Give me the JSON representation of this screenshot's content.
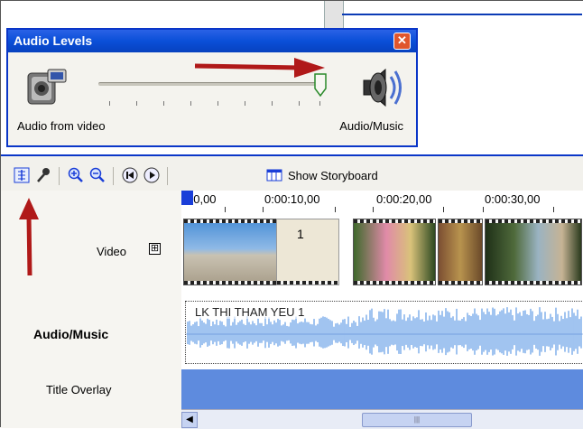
{
  "popup": {
    "title": "Audio Levels",
    "close_icon": "close-icon",
    "left_label": "Audio from video",
    "right_label": "Audio/Music",
    "slider_value": 1.0
  },
  "toolbar": {
    "storyboard_label": "Show Storyboard"
  },
  "ruler": {
    "times": [
      "00,00",
      "0:00:10,00",
      "0:00:20,00",
      "0:00:30,00"
    ]
  },
  "tracks": {
    "video_label": "Video",
    "expand_symbol": "⊞",
    "audio_label": "Audio/Music",
    "title_label": "Title Overlay"
  },
  "video_track": {
    "transition_number": "1"
  },
  "audio_track": {
    "clip_name": "LK THI THAM YEU 1"
  },
  "colors": {
    "title_bar": "#0a4fd8",
    "annotation_arrow": "#b01919",
    "title_overlay_track": "#5e8bde",
    "waveform": "#6ea3e8"
  }
}
